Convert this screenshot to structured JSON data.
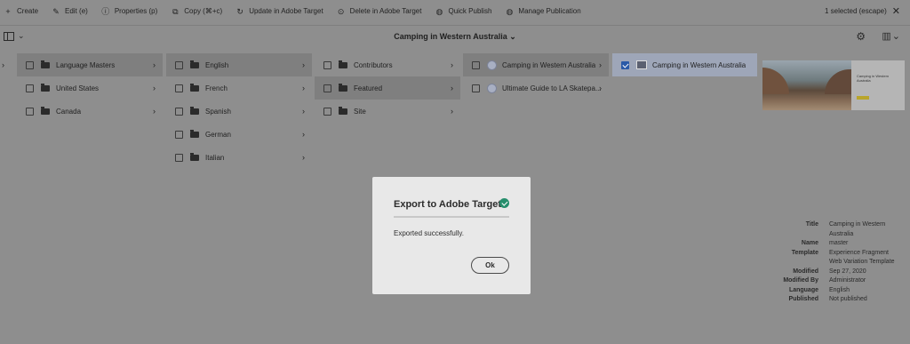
{
  "actionbar": {
    "actions": [
      {
        "icon": "plus-icon",
        "label": "Create"
      },
      {
        "icon": "pencil-icon",
        "label": "Edit (e)"
      },
      {
        "icon": "info-icon",
        "label": "Properties (p)"
      },
      {
        "icon": "copy-icon",
        "label": "Copy (⌘+c)"
      },
      {
        "icon": "refresh-icon",
        "label": "Update in Adobe Target"
      },
      {
        "icon": "delete-target-icon",
        "label": "Delete in Adobe Target"
      },
      {
        "icon": "globe-icon",
        "label": "Quick Publish"
      },
      {
        "icon": "globe-gear-icon",
        "label": "Manage Publication"
      }
    ],
    "selected_info": "1 selected (escape)"
  },
  "titlebar": {
    "title": "Camping in Western Australia"
  },
  "columns": {
    "col1": [
      "Language Masters",
      "United States",
      "Canada"
    ],
    "col2": [
      "English",
      "French",
      "Spanish",
      "German",
      "Italian"
    ],
    "col3": [
      "Contributors",
      "Featured",
      "Site"
    ],
    "col4": [
      "Camping in Western Australia",
      "Ultimate Guide to LA Skatepa..."
    ],
    "col5": [
      "Camping in Western Australia"
    ]
  },
  "preview": {
    "heading": "Camping in Western Australia"
  },
  "properties": {
    "title_key": "Title",
    "title_val": "Camping in Western Australia",
    "name_key": "Name",
    "name_val": "master",
    "template_key": "Template",
    "template_val": "Experience Fragment Web Variation Template",
    "modified_key": "Modified",
    "modified_val": "Sep 27, 2020",
    "modifiedby_key": "Modified By",
    "modifiedby_val": "Administrator",
    "language_key": "Language",
    "language_val": "English",
    "published_key": "Published",
    "published_val": "Not published"
  },
  "dialog": {
    "title": "Export to Adobe Target",
    "message": "Exported successfully.",
    "ok_label": "Ok"
  }
}
